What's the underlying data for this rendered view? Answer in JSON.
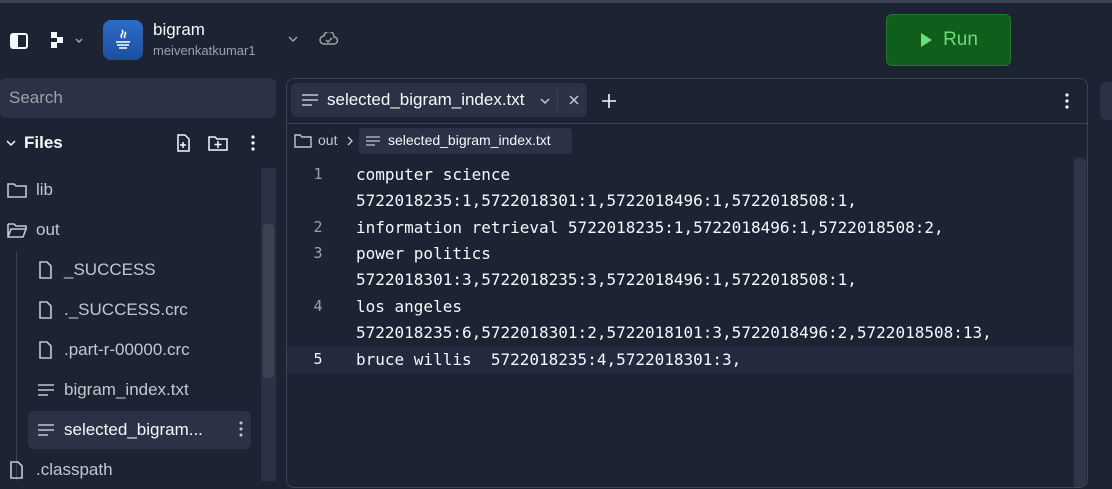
{
  "topbar": {
    "project_name": "bigram",
    "project_owner": "meivenkatkumar1",
    "run_label": "Run"
  },
  "sidebar": {
    "search_placeholder": "Search",
    "files_title": "Files",
    "items": [
      {
        "label": "lib",
        "type": "folder"
      },
      {
        "label": "out",
        "type": "folder-open"
      },
      {
        "label": "_SUCCESS",
        "type": "file"
      },
      {
        "label": "._SUCCESS.crc",
        "type": "file"
      },
      {
        "label": ".part-r-00000.crc",
        "type": "file"
      },
      {
        "label": "bigram_index.txt",
        "type": "text-file"
      },
      {
        "label": "selected_bigram...",
        "type": "text-file"
      },
      {
        "label": ".classpath",
        "type": "file"
      }
    ]
  },
  "editor": {
    "tab_label": "selected_bigram_index.txt",
    "breadcrumb": {
      "folder": "out",
      "file": "selected_bigram_index.txt"
    },
    "line_numbers": [
      "1",
      "2",
      "3",
      "4",
      "5"
    ],
    "lines": [
      "computer science",
      "5722018235:1,5722018301:1,5722018496:1,5722018508:1,",
      "information retrieval 5722018235:1,5722018496:1,5722018508:2,",
      "power politics",
      "5722018301:3,5722018235:3,5722018496:1,5722018508:1,",
      "los angeles",
      "5722018235:6,5722018301:2,5722018101:3,5722018496:2,5722018508:13,",
      "bruce willis  5722018235:4,5722018301:3,"
    ],
    "active_line": 5
  },
  "colors": {
    "background": "#1c2333",
    "run_button": "#0f5e1c",
    "run_text": "#6bdd77",
    "panel": "#2b3245"
  }
}
